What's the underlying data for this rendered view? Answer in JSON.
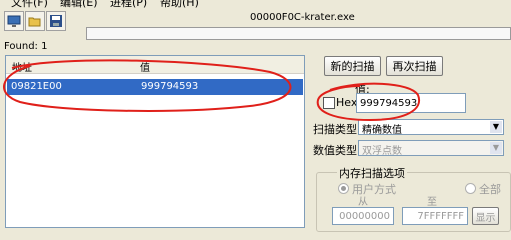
{
  "menu": [
    "文件(F)",
    "编辑(E)",
    "进程(P)",
    "帮助(H)"
  ],
  "toolbar": {
    "icons": [
      "computer-icon",
      "open-folder-icon",
      "save-disk-icon"
    ]
  },
  "process_title": "00000F0C-krater.exe",
  "found_label": "Found: 1",
  "results": {
    "columns": [
      "地址",
      "值"
    ],
    "rows": [
      {
        "address": "09821E00",
        "value": "999794593"
      }
    ]
  },
  "buttons": {
    "new_scan": "新的扫描",
    "next_scan": "再次扫描"
  },
  "value_label": "值:",
  "hex_label": "Hex",
  "value_input": "999794593",
  "scan_type": {
    "label": "扫描类型",
    "selected": "精确数值"
  },
  "value_type": {
    "label": "数值类型",
    "selected": "双浮点数"
  },
  "memory_options": {
    "title": "内存扫描选项",
    "user_mode": "用户方式",
    "all": "全部",
    "from_label": "从",
    "to_label": "至",
    "from_value": "00000000",
    "to_value": "7FFFFFFF",
    "show_button": "显示"
  },
  "colors": {
    "selection": "#316ac5",
    "annotation": "#e0201a"
  }
}
